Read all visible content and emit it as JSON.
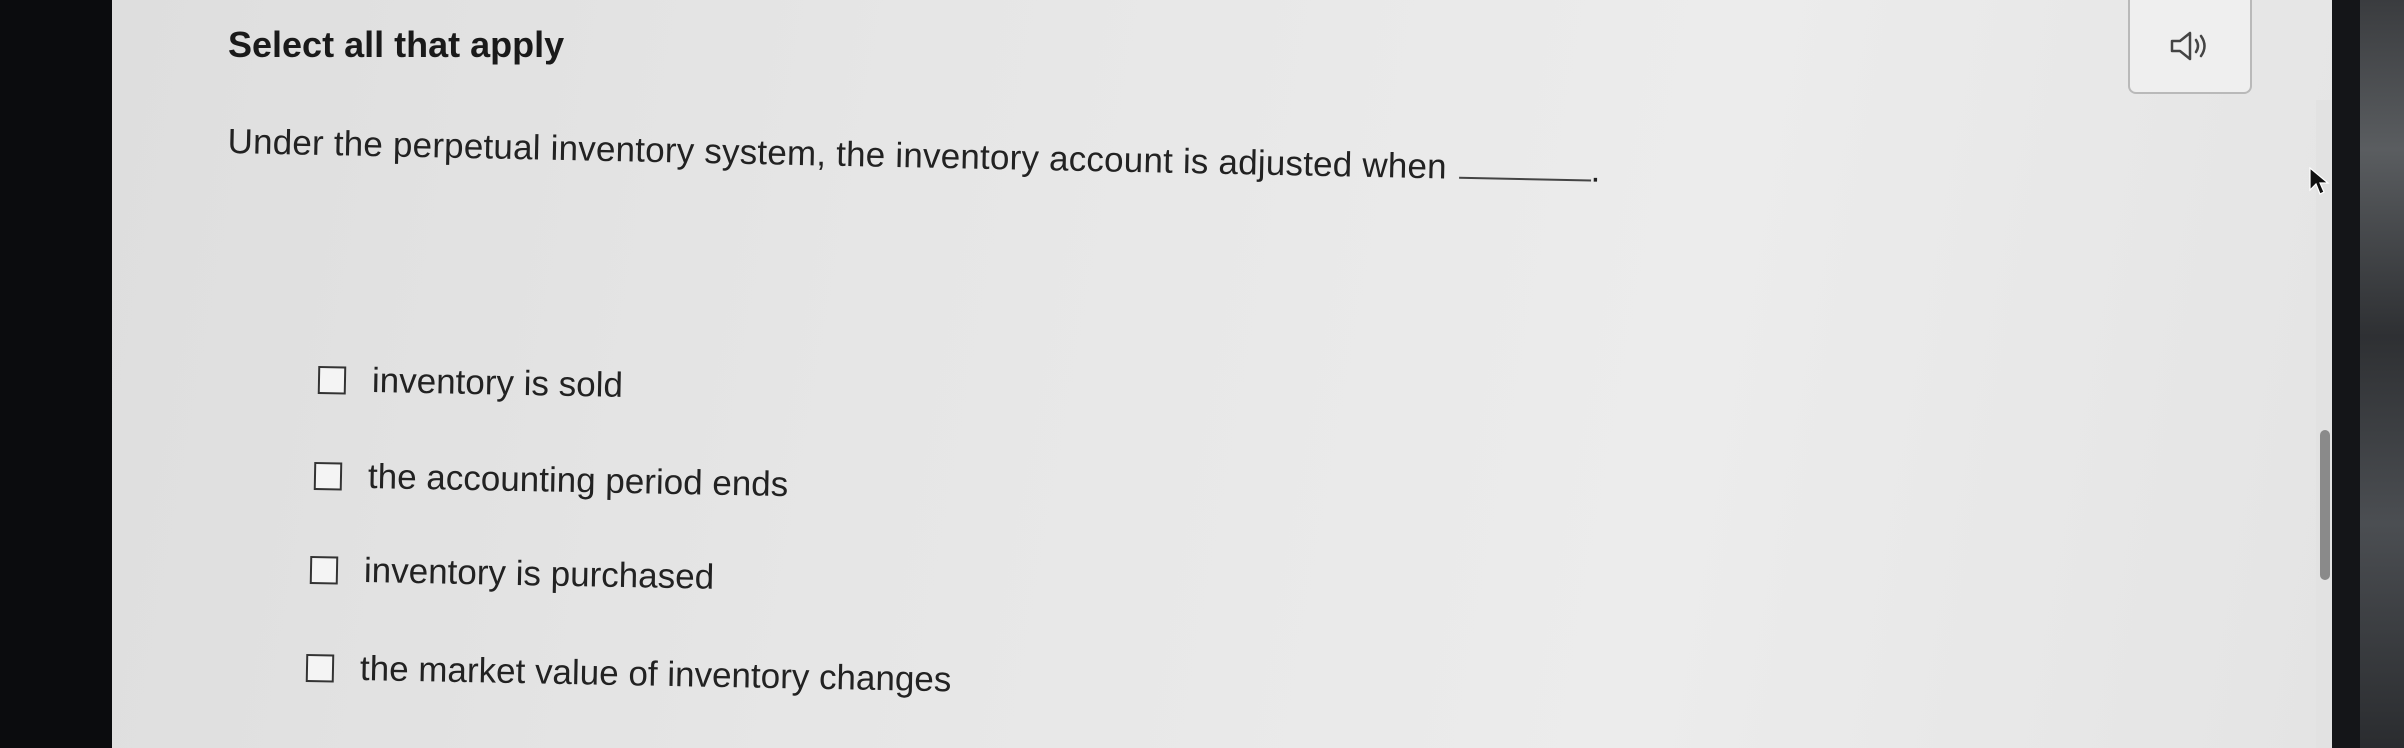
{
  "header": {
    "title": "Select all that apply"
  },
  "audio": {
    "icon": "speaker-icon"
  },
  "question": {
    "text": "Under the perpetual inventory system, the inventory account is adjusted when",
    "end": "."
  },
  "options": [
    {
      "label": "inventory is sold"
    },
    {
      "label": "the accounting period ends"
    },
    {
      "label": "inventory is purchased"
    },
    {
      "label": "the market value of inventory changes"
    }
  ],
  "colors": {
    "background": "#e6e6e6",
    "text": "#222222",
    "bezel": "#0b0c0e"
  }
}
